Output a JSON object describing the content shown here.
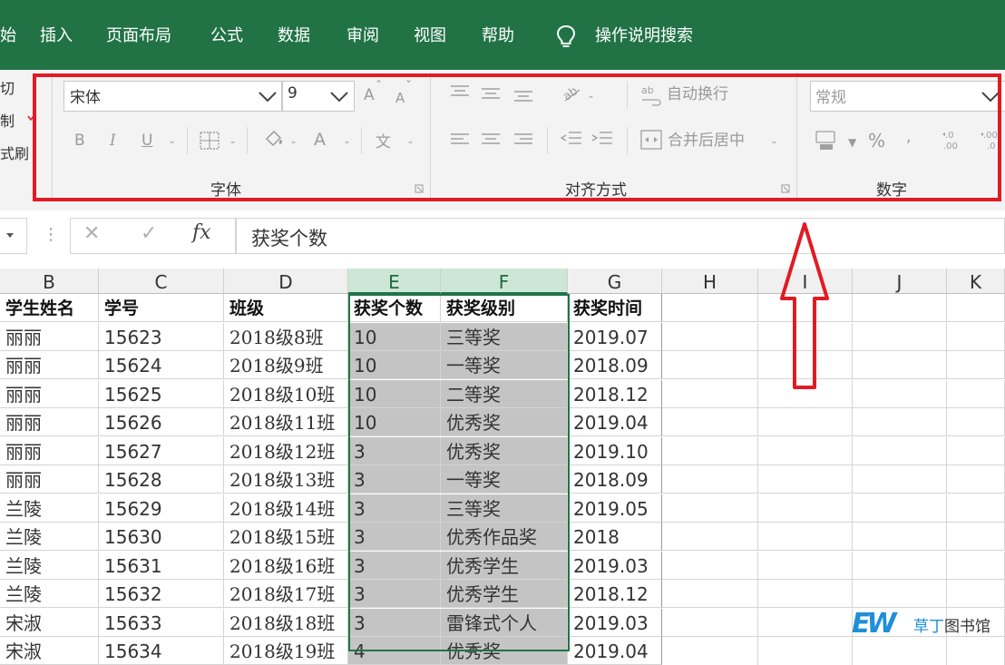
{
  "menu": {
    "partial_home": "始",
    "items": [
      "插入",
      "页面布局",
      "公式",
      "数据",
      "审阅",
      "视图",
      "帮助"
    ],
    "tell_me": "操作说明搜索"
  },
  "clipboard": {
    "cut_partial": "切",
    "copy_partial": "制",
    "painter_partial": "式刷"
  },
  "font": {
    "font_name": "宋体",
    "font_size": "9",
    "grow": "A",
    "shrink": "A",
    "bold": "B",
    "italic": "I",
    "underline": "U",
    "font_color": "A",
    "phonetic": "文",
    "group_label": "字体"
  },
  "alignment": {
    "wrap_text": "自动换行",
    "merge_center": "合并后居中",
    "group_label": "对齐方式"
  },
  "number": {
    "format": "常规",
    "percent": "%",
    "comma": ",",
    "inc_decimal": ".0\n.00",
    "dec_decimal": ".00\n.0",
    "group_label": "数字"
  },
  "formula_bar": {
    "cancel": "✕",
    "enter": "✓",
    "fx": "fx",
    "content": "获奖个数"
  },
  "columns": [
    "B",
    "C",
    "D",
    "E",
    "F",
    "G",
    "H",
    "I",
    "J",
    "K"
  ],
  "selected_columns": [
    "E",
    "F"
  ],
  "table": {
    "header": [
      "学生姓名",
      "学号",
      "班级",
      "获奖个数",
      "获奖级别",
      "获奖时间"
    ],
    "rows": [
      [
        "丽丽",
        "15623",
        "2018级8班",
        "10",
        "三等奖",
        "2019.07"
      ],
      [
        "丽丽",
        "15624",
        "2018级9班",
        "10",
        "一等奖",
        "2018.09"
      ],
      [
        "丽丽",
        "15625",
        "2018级10班",
        "10",
        "二等奖",
        "2018.12"
      ],
      [
        "丽丽",
        "15626",
        "2018级11班",
        "10",
        "优秀奖",
        "2019.04"
      ],
      [
        "丽丽",
        "15627",
        "2018级12班",
        "3",
        "优秀奖",
        "2019.10"
      ],
      [
        "丽丽",
        "15628",
        "2018级13班",
        "3",
        "一等奖",
        "2018.09"
      ],
      [
        "兰陵",
        "15629",
        "2018级14班",
        "3",
        "三等奖",
        "2019.05"
      ],
      [
        "兰陵",
        "15630",
        "2018级15班",
        "3",
        "优秀作品奖",
        "2018"
      ],
      [
        "兰陵",
        "15631",
        "2018级16班",
        "3",
        "优秀学生",
        "2019.03"
      ],
      [
        "兰陵",
        "15632",
        "2018级17班",
        "3",
        "优秀学生",
        "2018.12"
      ],
      [
        "宋淑",
        "15633",
        "2018级18班",
        "3",
        "雷锋式个人",
        "2019.03"
      ],
      [
        "宋淑",
        "15634",
        "2018级19班",
        "4",
        "优秀奖",
        "2019.04"
      ]
    ]
  },
  "watermark": {
    "letters": "EW",
    "text": "草丁图书馆"
  },
  "colors": {
    "ribbon_green": "#217346",
    "annotation_red": "#e01b24",
    "selection_fill": "#c4c4c4"
  }
}
